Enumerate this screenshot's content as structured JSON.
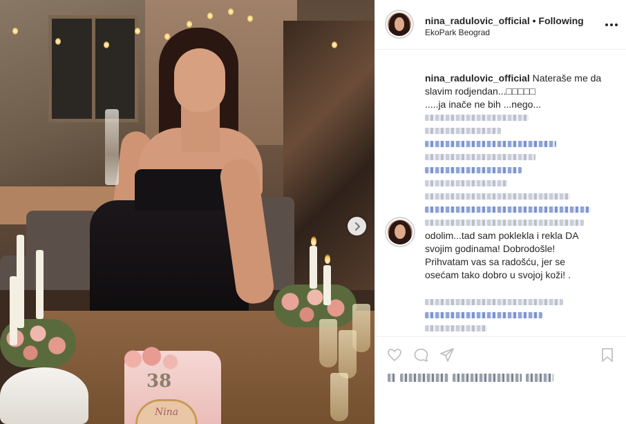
{
  "post": {
    "username": "nina_radulovic_official",
    "separator": "•",
    "follow_status": "Following",
    "location": "EkoPark Beograd"
  },
  "caption": {
    "username": "nina_radulovic_official",
    "line1": "Nateraše me da slavim rodjendan...",
    "emoji": "□□□□□",
    "line2": ".....ja inače ne bih ...nego...",
    "line_end_1": "odolim...tad sam poklekla i rekla DA",
    "line_end_2": "svojim godinama! Dobrodošle!",
    "line_end_3": "Prihvatam vas sa radošću, jer se",
    "line_end_4": "osećam tako dobro u svojoj koži! ."
  },
  "photo": {
    "cake_number": "38",
    "cake_plaque": "Nina"
  },
  "icons": {
    "more": "more-options-icon",
    "next": "chevron-right-icon",
    "like": "heart-icon",
    "comment": "comment-icon",
    "share": "share-icon",
    "save": "bookmark-icon"
  },
  "colors": {
    "text": "#262626",
    "border": "#efefef",
    "muted": "#8e8e8e"
  }
}
